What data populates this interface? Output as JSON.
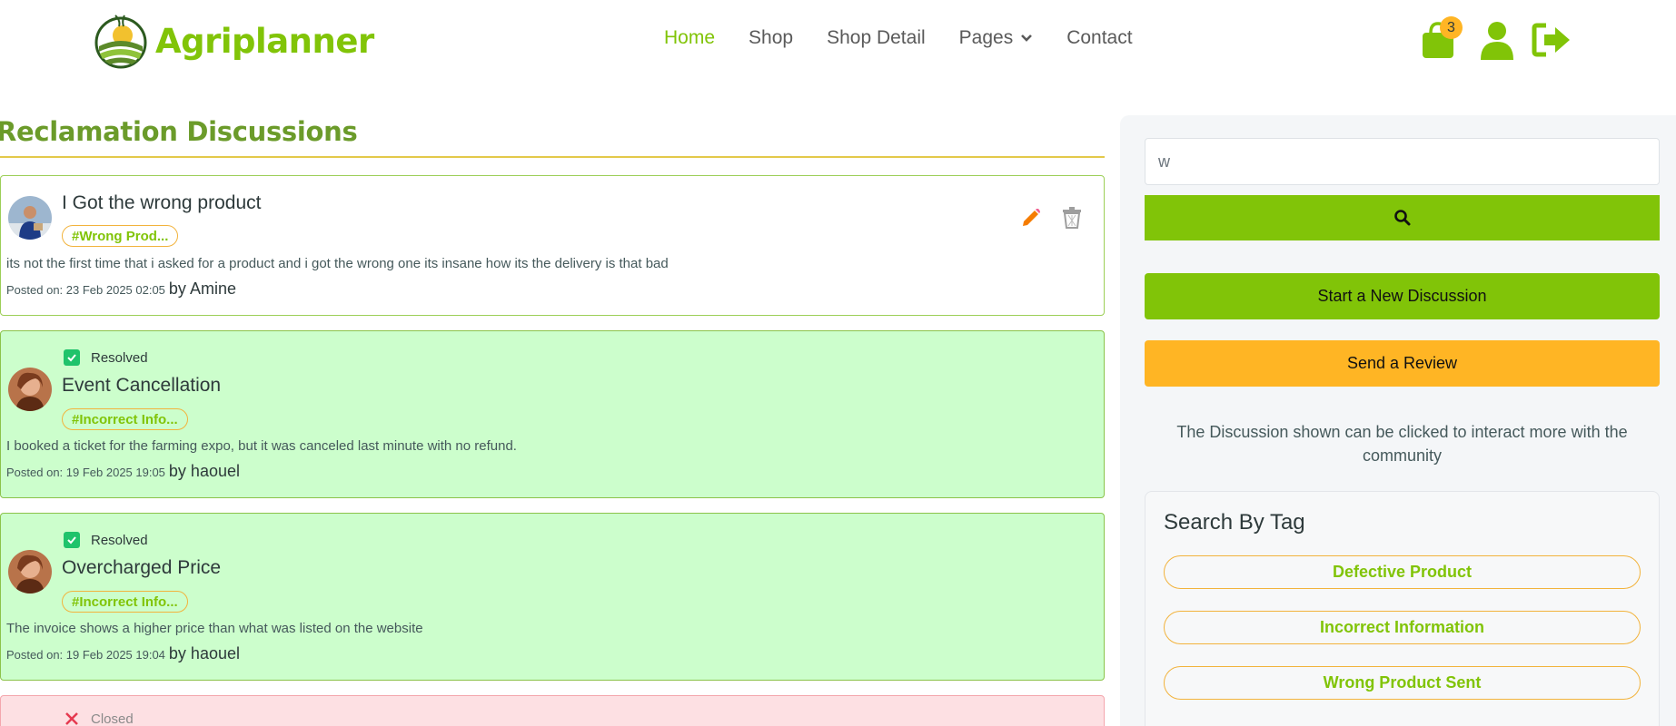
{
  "brand": {
    "name": "Agriplanner"
  },
  "nav": {
    "items": [
      {
        "label": "Home",
        "active": true
      },
      {
        "label": "Shop"
      },
      {
        "label": "Shop Detail"
      },
      {
        "label": "Pages",
        "dropdown": true
      },
      {
        "label": "Contact"
      }
    ]
  },
  "header_icons": {
    "cart_count": "3",
    "cart_icon": "shopping-bag-icon",
    "user_icon": "user-icon",
    "logout_icon": "sign-out-icon"
  },
  "colors": {
    "accent": "#81c408",
    "secondary": "#ffb524",
    "resolved_bg": "#ccfecc",
    "closed_bg": "#fde0e3"
  },
  "main": {
    "title": "Reclamation Discussions",
    "discussions": [
      {
        "title": "I Got the wrong product",
        "tag": "#Wrong Prod...",
        "body": "its not the first time that i asked for a product and i got the wrong one its insane how its the delivery is that bad",
        "posted": "Posted on: 23 Feb 2025 02:05",
        "by": "by Amine"
      },
      {
        "status": "Resolved",
        "title": "Event Cancellation",
        "tag": "#Incorrect Info...",
        "body": "I booked a ticket for the farming expo, but it was canceled last minute with no refund.",
        "posted": "Posted on: 19 Feb 2025 19:05",
        "by": "by haouel"
      },
      {
        "status": "Resolved",
        "title": "Overcharged Price",
        "tag": "#Incorrect Info...",
        "body": "The invoice shows a higher price than what was listed on the website",
        "posted": "Posted on: 19 Feb 2025 19:04",
        "by": "by haouel"
      },
      {
        "status": "Closed"
      }
    ]
  },
  "sidebar": {
    "search_value": "w",
    "new_discussion_label": "Start a New Discussion",
    "review_label": "Send a Review",
    "info_text": "The Discussion shown can be clicked to interact more with the community",
    "tag_box_title": "Search By Tag",
    "tags": [
      "Defective Product",
      "Incorrect Information",
      "Wrong Product Sent"
    ]
  }
}
